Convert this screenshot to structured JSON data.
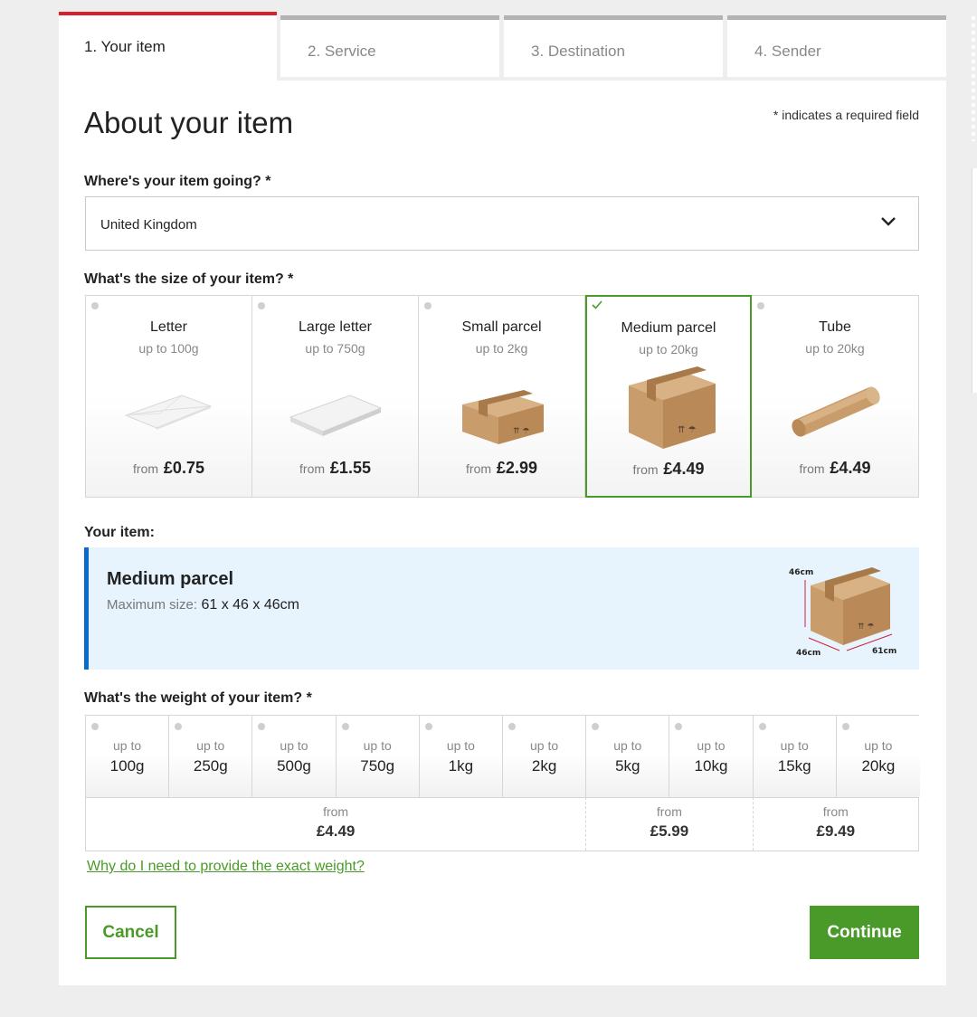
{
  "steps": [
    {
      "label": "1. Your item",
      "active": true
    },
    {
      "label": "2. Service",
      "active": false
    },
    {
      "label": "3. Destination",
      "active": false
    },
    {
      "label": "4. Sender",
      "active": false
    }
  ],
  "title": "About your item",
  "required_note": "* indicates a required field",
  "destination": {
    "label": "Where's your item going? *",
    "value": "United Kingdom"
  },
  "size": {
    "label": "What's the size of your item? *",
    "options": [
      {
        "name": "Letter",
        "limit": "up to 100g",
        "from": "from",
        "price": "£0.75",
        "icon": "letter-envelope-icon"
      },
      {
        "name": "Large letter",
        "limit": "up to 750g",
        "from": "from",
        "price": "£1.55",
        "icon": "large-letter-icon"
      },
      {
        "name": "Small parcel",
        "limit": "up to 2kg",
        "from": "from",
        "price": "£2.99",
        "icon": "small-parcel-box-icon"
      },
      {
        "name": "Medium parcel",
        "limit": "up to 20kg",
        "from": "from",
        "price": "£4.49",
        "icon": "medium-parcel-box-icon",
        "selected": true
      },
      {
        "name": "Tube",
        "limit": "up to 20kg",
        "from": "from",
        "price": "£4.49",
        "icon": "tube-icon"
      }
    ]
  },
  "your_item": {
    "label": "Your item:",
    "name": "Medium parcel",
    "max_label": "Maximum size:",
    "max_value": "61 x 46 x 46cm",
    "dims": {
      "height": "46cm",
      "depth": "46cm",
      "length": "61cm"
    }
  },
  "weight": {
    "label": "What's the weight of your item? *",
    "options": [
      {
        "up": "up to",
        "w": "100g"
      },
      {
        "up": "up to",
        "w": "250g"
      },
      {
        "up": "up to",
        "w": "500g"
      },
      {
        "up": "up to",
        "w": "750g"
      },
      {
        "up": "up to",
        "w": "1kg"
      },
      {
        "up": "up to",
        "w": "2kg"
      },
      {
        "up": "up to",
        "w": "5kg"
      },
      {
        "up": "up to",
        "w": "10kg"
      },
      {
        "up": "up to",
        "w": "15kg"
      },
      {
        "up": "up to",
        "w": "20kg"
      }
    ],
    "bands": [
      {
        "from": "from",
        "price": "£4.49"
      },
      {
        "from": "from",
        "price": "£5.99"
      },
      {
        "from": "from",
        "price": "£9.49"
      }
    ]
  },
  "why_link": "Why do I need to provide the exact weight?",
  "buttons": {
    "cancel": "Cancel",
    "continue": "Continue"
  },
  "colors": {
    "accent_red": "#da202a",
    "green": "#4a9a2a",
    "blue": "#0a6cc8",
    "info_bg": "#e8f4fd"
  }
}
